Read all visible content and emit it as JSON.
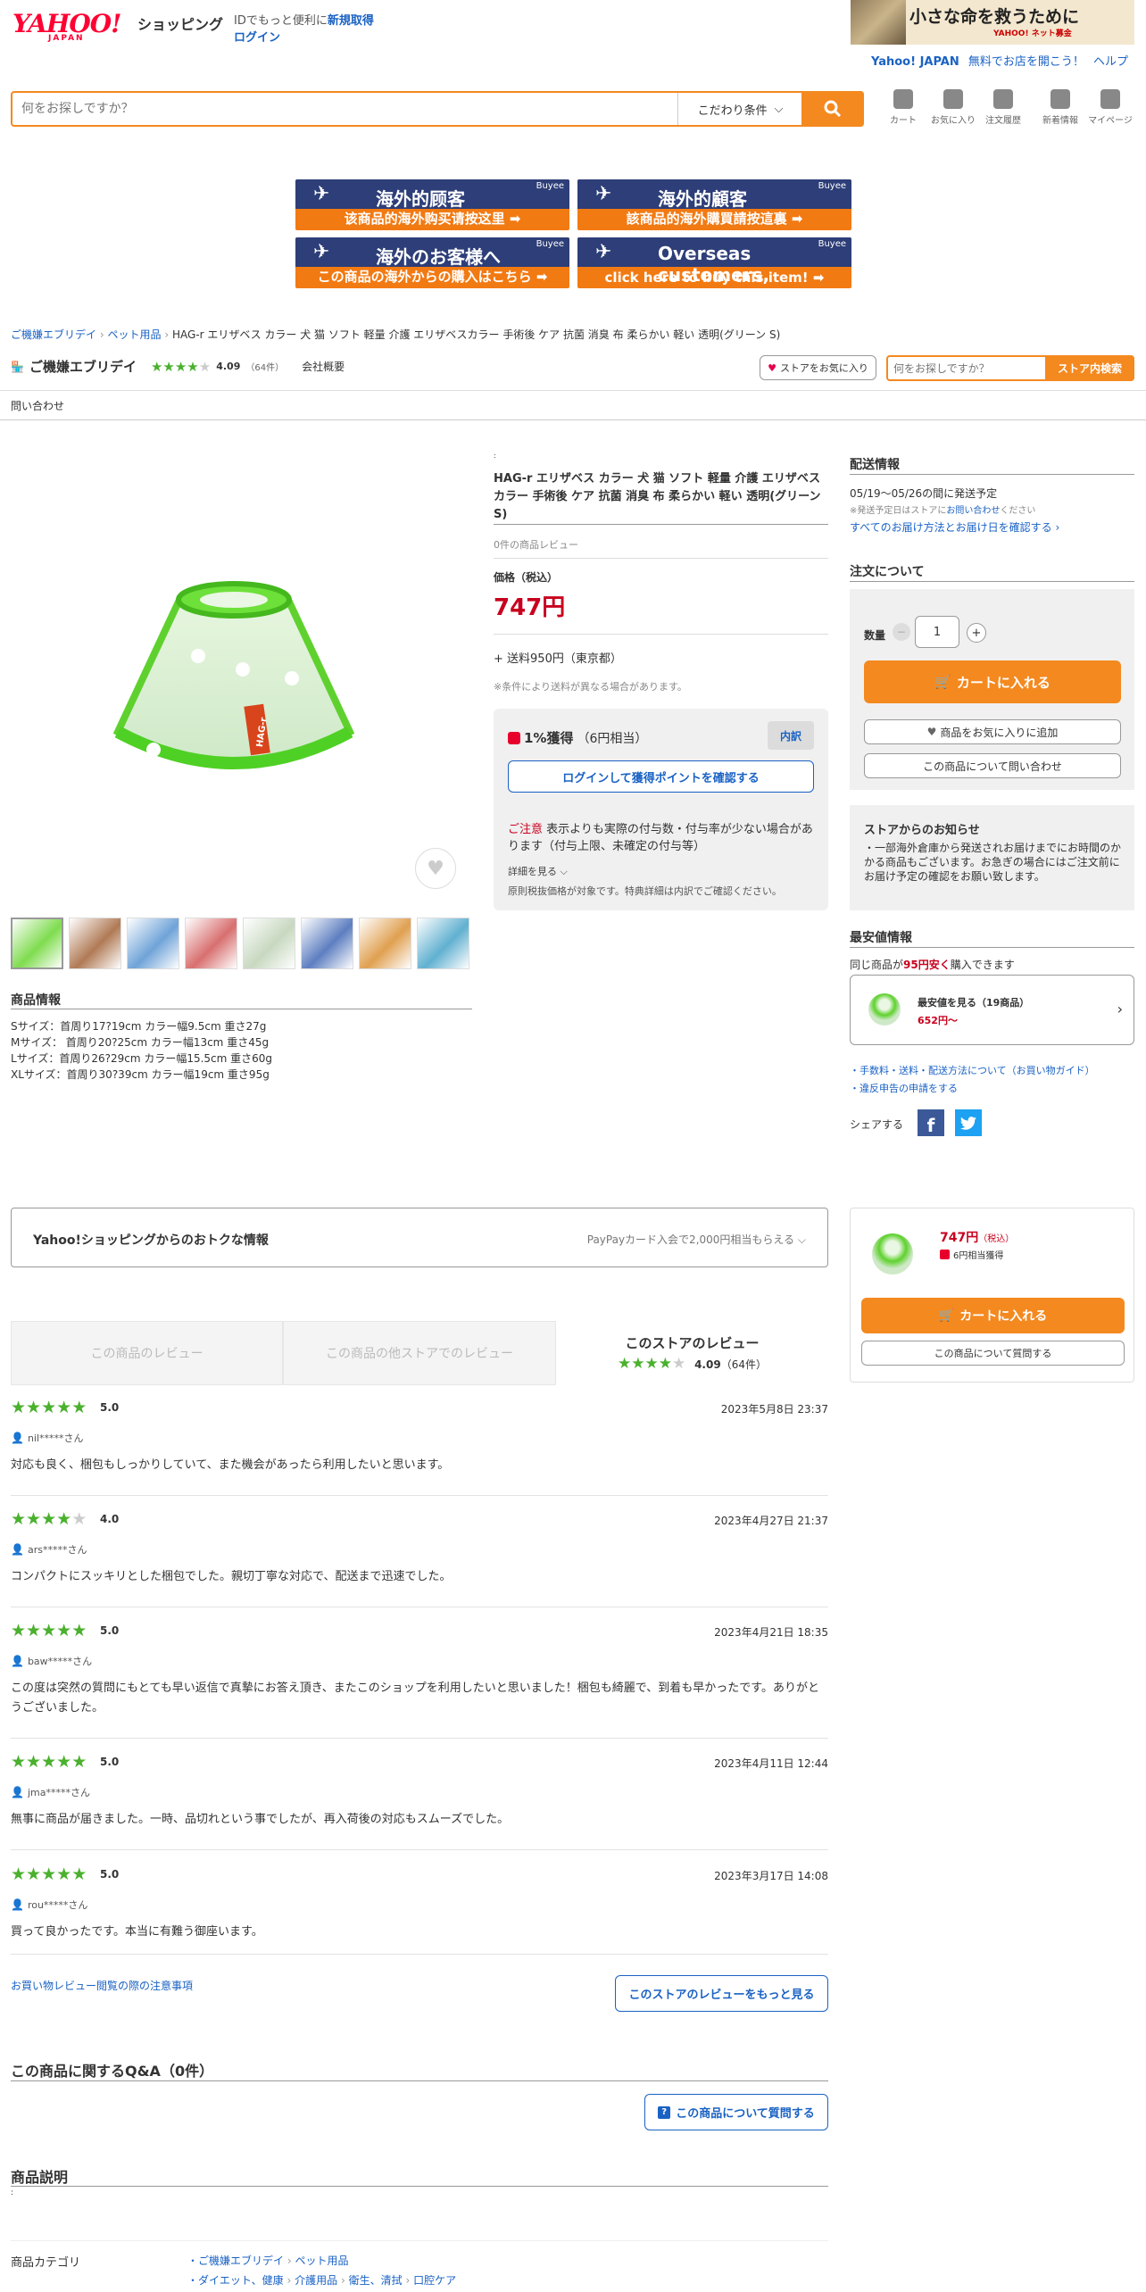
{
  "header": {
    "logo_main": "YAHOO!",
    "logo_sub": "JAPAN",
    "logo_shopping": "ショッピング",
    "id_promo": "IDでもっと便利に",
    "signup_link": "新規取得",
    "login_link": "ログイン",
    "ad_text": "小さな命を救うために",
    "ad_sub": "YAHOO! ネット募金",
    "yj_link": "Yahoo! JAPAN",
    "open_store_link": "無料でお店を開こう！",
    "help_link": "ヘルプ"
  },
  "search": {
    "placeholder": "何をお探しですか？",
    "filter_label": "こだわり条件"
  },
  "nav_icons": [
    {
      "label": "カート",
      "icon": "cart-icon"
    },
    {
      "label": "お気に入り",
      "icon": "heart-icon"
    },
    {
      "label": "注文履歴",
      "icon": "yen-history-icon"
    },
    {
      "label": "新着情報",
      "icon": "bell-icon"
    },
    {
      "label": "マイページ",
      "icon": "person-icon"
    }
  ],
  "banners": [
    {
      "title": "海外的顾客",
      "sub": "该商品的海外购买请按这里 ➡",
      "logo": "Buyee"
    },
    {
      "title": "海外的顧客",
      "sub": "該商品的海外購買請按這裏 ➡",
      "logo": "Buyee"
    },
    {
      "title": "海外のお客様へ",
      "sub": "この商品の海外からの購入はこちら ➡",
      "logo": "Buyee"
    },
    {
      "title": "Overseas customers,",
      "sub": "click here to buy this item! ➡",
      "logo": "Buyee"
    }
  ],
  "breadcrumb": [
    "ご機嫌エブリデイ",
    "ペット用品",
    "HAG-r エリザベス カラー 犬 猫 ソフト 軽量 介護 エリザベスカラー 手術後 ケア 抗菌 消臭 布 柔らかい 軽い 透明(グリーン S)"
  ],
  "store": {
    "name": "ご機嫌エブリデイ",
    "rating": "4.09",
    "rating_count": "（64件）",
    "company_link": "会社概要",
    "fav_button": "ストアをお気に入り",
    "search_placeholder": "何をお探しですか？",
    "search_button": "ストア内検索",
    "contact_link": "問い合わせ"
  },
  "product": {
    "title": "HAG-r エリザベス カラー 犬 猫 ソフト 軽量 介護 エリザベスカラー 手術後 ケア 抗菌 消臭 布 柔らかい 軽い 透明(グリーン S)",
    "review_count": "0件の商品レビュー",
    "price_label": "価格（税込）",
    "price": "747円",
    "shipping": "+ 送料950円（東京都）",
    "shipping_note": "※条件により送料が異なる場合があります。",
    "points_title": "1%獲得",
    "points_sub": "（6円相当）",
    "points_tag": "内訳",
    "login_points_button": "ログインして獲得ポイントを確認する",
    "caution_label": "ご注意",
    "caution_text": "表示よりも実際の付与数・付与率が少ない場合があります（付与上限、未確定の付与等）",
    "details_link": "詳細を見る",
    "tax_note": "原則税抜価格が対象です。特典詳細は内訳でご確認ください。",
    "brand_tag": "HAG-r",
    "small_dot": ":"
  },
  "product_info": {
    "title": "商品情報",
    "lines": [
      "Sサイズ：首周り17?19cm カラー幅9.5cm 重さ27g",
      "Mサイズ： 首周り20?25cm カラー幅13cm 重さ45g",
      "Lサイズ：首周り26?29cm カラー幅15.5cm 重さ60g",
      "XLサイズ：首周り30?39cm カラー幅19cm 重さ95g"
    ]
  },
  "delivery": {
    "title": "配送情報",
    "date": "05/19〜05/26の間に発送予定",
    "note_prefix": "※発送予定日はストアに",
    "note_link": "お問い合わせ",
    "note_suffix": "ください",
    "all_link": "すべてのお届け方法とお届け日を確認する"
  },
  "order": {
    "title": "注文について",
    "qty_label": "数量",
    "qty_value": "1",
    "minus": "−",
    "plus": "+",
    "cart_button": "カートに入れる",
    "fav_button": "商品をお気に入りに追加",
    "inquiry_button": "この商品について問い合わせ"
  },
  "notice": {
    "title": "ストアからのお知らせ",
    "text": "・一部海外倉庫から発送されお届けまでにお時間のかかる商品もございます。お急ぎの場合にはご注文前にお届け予定の確認をお願い致します。"
  },
  "lowest": {
    "title": "最安値情報",
    "pre": "同じ商品が",
    "highlight": "95円安く",
    "post": "購入できます",
    "box_title": "最安値を見る（19商品）",
    "box_price": "652円〜"
  },
  "links": [
    "手数料・送料・配送方法について（お買い物ガイド）",
    "違反申告の申請をする"
  ],
  "share_label": "シェアする",
  "promo": {
    "title": "Yahoo!ショッピングからのおトクな情報",
    "right": "PayPayカード入会で2,000円相当もらえる"
  },
  "sticky": {
    "price": "747円",
    "tax": "（税込）",
    "points": "6円相当獲得",
    "cart_button": "カートに入れる",
    "ask_button": "この商品について質問する"
  },
  "review_tabs": {
    "tab1": "この商品のレビュー",
    "tab2": "この商品の他ストアでのレビュー",
    "tab3": "このストアのレビュー",
    "tab3_score": "4.09",
    "tab3_count": "（64件）"
  },
  "reviews": [
    {
      "stars": 5,
      "score": "5.0",
      "date": "2023年5月8日 23:37",
      "user": "nil*****さん",
      "text": "対応も良く、梱包もしっかりしていて、また機会があったら利用したいと思います。"
    },
    {
      "stars": 4,
      "score": "4.0",
      "date": "2023年4月27日 21:37",
      "user": "ars*****さん",
      "text": "コンパクトにスッキリとした梱包でした。親切丁寧な対応で、配送まで迅速でした。"
    },
    {
      "stars": 5,
      "score": "5.0",
      "date": "2023年4月21日 18:35",
      "user": "baw*****さん",
      "text": "この度は突然の質問にもとても早い返信で真摯にお答え頂き、またこのショップを利用したいと思いました！梱包も綺麗で、到着も早かったです。ありがとうございました。"
    },
    {
      "stars": 5,
      "score": "5.0",
      "date": "2023年4月11日 12:44",
      "user": "jma*****さん",
      "text": "無事に商品が届きました。一時、品切れという事でしたが、再入荷後の対応もスムーズでした。"
    },
    {
      "stars": 5,
      "score": "5.0",
      "date": "2023年3月17日 14:08",
      "user": "rou*****さん",
      "text": "買って良かったです。本当に有難う御座います。"
    }
  ],
  "review_footer": {
    "notes_link": "お買い物レビュー閲覧の際の注意事項",
    "more_button": "このストアのレビューをもっと見る"
  },
  "qa": {
    "title": "この商品に関するQ&A（0件）",
    "ask_button": "この商品について質問する"
  },
  "description": {
    "title": "商品説明",
    "dot": ":"
  },
  "category": {
    "label": "商品カテゴリ",
    "row1": [
      "ご機嫌エブリデイ",
      "ペット用品"
    ],
    "row2": [
      "ダイエット、健康",
      "介護用品",
      "衛生、清拭",
      "口腔ケア"
    ]
  },
  "colors": {
    "accent": "#f4891f",
    "link": "#1a62c4",
    "price": "#c8001e",
    "star": "#4ab02d"
  }
}
